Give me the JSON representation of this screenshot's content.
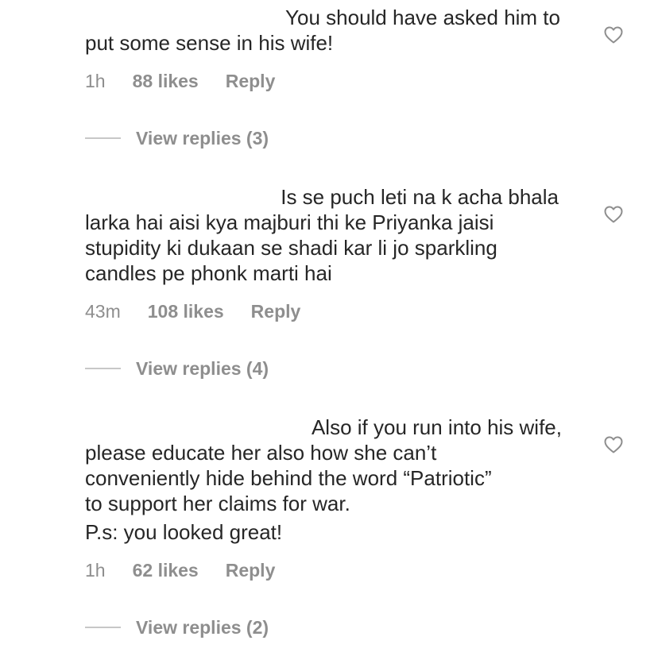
{
  "comments": [
    {
      "text_first_line": "You should have asked him to",
      "text_rest": "put some sense in his wife!",
      "time": "1h",
      "likes": "88 likes",
      "reply_label": "Reply",
      "view_replies": "View replies (3)"
    },
    {
      "text_first_line": "Is se puch leti na k acha bhala",
      "text_rest": "larka hai aisi kya majburi thi ke Priyanka jaisi\nstupidity ki dukaan se shadi kar li jo sparkling\ncandles pe phonk marti hai",
      "time": "43m",
      "likes": "108 likes",
      "reply_label": "Reply",
      "view_replies": "View replies (4)"
    },
    {
      "text_first_line": "Also if you run into his wife,",
      "text_rest": "please educate her also how she can’t\nconveniently hide behind the word “Patriotic”\nto support her claims for war.",
      "text_extra": "P.s: you looked great!",
      "time": "1h",
      "likes": "62 likes",
      "reply_label": "Reply",
      "view_replies": "View replies (2)"
    }
  ],
  "icons": {
    "like": "heart-outline-icon"
  },
  "colors": {
    "text": "#262626",
    "meta": "#8e8e8e",
    "divider": "#c7c7c7"
  }
}
